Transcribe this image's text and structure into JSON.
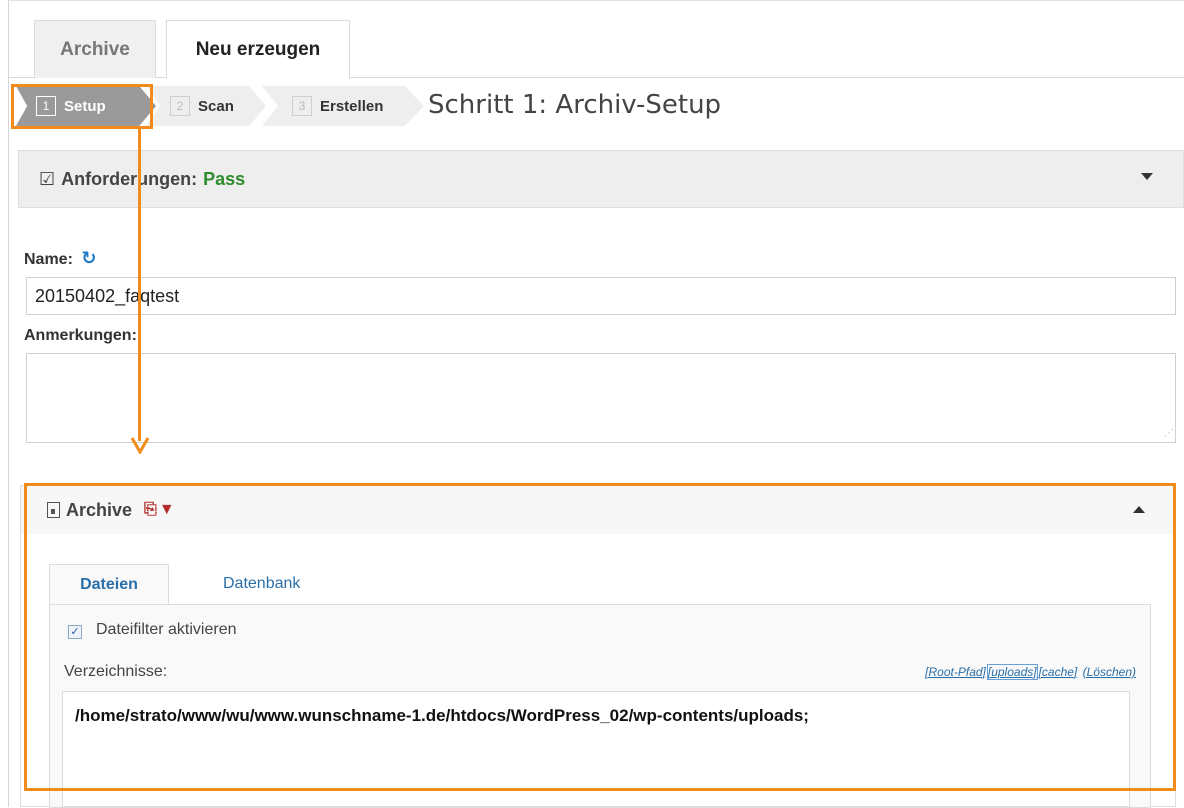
{
  "top_tabs": [
    {
      "label": "Archive",
      "active": false
    },
    {
      "label": "Neu erzeugen",
      "active": true
    }
  ],
  "wizard": {
    "steps": [
      {
        "num": "1",
        "label": "Setup",
        "active": true
      },
      {
        "num": "2",
        "label": "Scan",
        "active": false
      },
      {
        "num": "3",
        "label": "Erstellen",
        "active": false
      }
    ],
    "title": "Schritt 1: Archiv-Setup"
  },
  "requirements": {
    "label": "Anforderungen:",
    "status": "Pass"
  },
  "form": {
    "name_label": "Name:",
    "name_value": "20150402_faqtest",
    "notes_label": "Anmerkungen:",
    "notes_value": ""
  },
  "archive": {
    "title": "Archive",
    "tabs": [
      {
        "label": "Dateien",
        "active": true
      },
      {
        "label": "Datenbank",
        "active": false
      }
    ],
    "filter_checkbox_label": "Dateifilter aktivieren",
    "filter_checked": true,
    "directories_label": "Verzeichnisse:",
    "directory_links": [
      "[Root-Pfad]",
      "[uploads]",
      "[cache]",
      "(Löschen)"
    ],
    "directories_value": "/home/strato/www/wu/www.wunschname-1.de/htdocs/WordPress_02/wp-contents/uploads;"
  },
  "colors": {
    "highlight": "#f28a1c",
    "pass": "#2e8b2e",
    "link": "#2a6fa8",
    "icon_red": "#b32d2d"
  }
}
